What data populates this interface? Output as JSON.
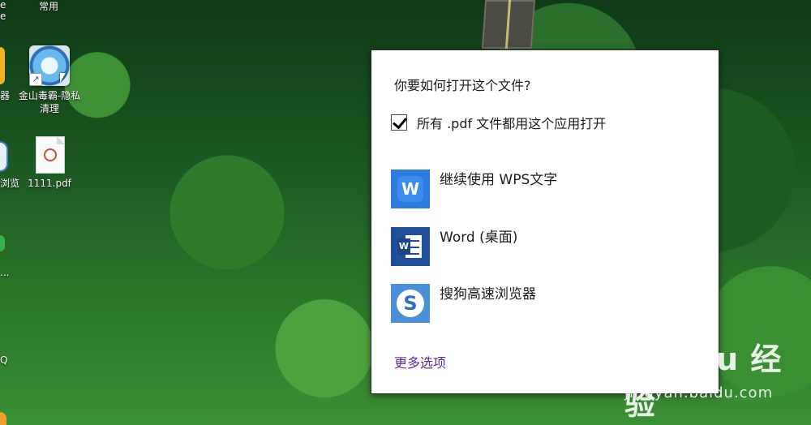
{
  "desktop": {
    "top_label": "常用",
    "icons": [
      {
        "label": "金山毒霸-隐私清理"
      },
      {
        "label": "1111.pdf"
      }
    ],
    "cut_labels": [
      "e",
      "e",
      "器",
      "浏览",
      "...",
      "Q"
    ]
  },
  "dialog": {
    "title": "你要如何打开这个文件?",
    "always_use": {
      "label": "所有 .pdf 文件都用这个应用打开",
      "checked": true
    },
    "apps": [
      {
        "name": "继续使用 WPS文字",
        "icon": "wps-icon"
      },
      {
        "name": "Word (桌面)",
        "icon": "word-icon"
      },
      {
        "name": "搜狗高速浏览器",
        "icon": "sogou-browser-icon"
      }
    ],
    "more_options": "更多选项"
  },
  "watermark": {
    "logo": "Bai du 经验",
    "url": "jingyan.baidu.com"
  },
  "colors": {
    "link": "#5a2d91",
    "wps": "#2b7cde",
    "word": "#1f4e9b",
    "sogou": "#4a90d9"
  }
}
